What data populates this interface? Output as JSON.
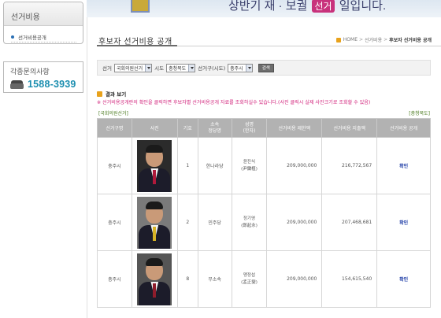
{
  "sidebar": {
    "title": "선거비용",
    "menu_item": "선거비용공개",
    "contact_title": "각종문의사항",
    "contact_number": "1588-3939"
  },
  "banner": {
    "text_before": "상반기 재 · 보궐",
    "chip": "선거",
    "text_after": "일입니다."
  },
  "page": {
    "title": "후보자 선거비용 공개",
    "breadcrumb": [
      "HOME",
      "선거비용",
      "후보자 선거비용 공개"
    ]
  },
  "search": {
    "election_label": "선거",
    "election_value": "국회의원선거",
    "province_label": "시도",
    "province_value": "충청북도",
    "district_label": "선거구(시도)",
    "district_value": "충주시",
    "button": "검색"
  },
  "results": {
    "label": "결과 보기",
    "notice": "※ 선거비용공개란의 확인을 클릭하면 후보자별 선거비용공개 자료를 조회하실수 있습니다.(사진 클릭시 실제 사진크기로 조회할 수 있음)",
    "tag_left": "[국회의원선거]",
    "tag_right": "[충청북도]",
    "headers": [
      "선거구명",
      "사진",
      "기호",
      "소속\n정당명",
      "성명\n(한자)",
      "선거비용 제한액",
      "선거비용 지출액",
      "선거비용 공개"
    ],
    "rows": [
      {
        "district": "충주시",
        "number": "1",
        "party": "한나라당",
        "name": "윤진식",
        "hanja": "(尹鎭植)",
        "limit": "209,000,000",
        "spent": "216,772,567",
        "action": "확인"
      },
      {
        "district": "충주시",
        "number": "2",
        "party": "민주당",
        "name": "정기영",
        "hanja": "(鄭起永)",
        "limit": "209,000,000",
        "spent": "207,468,681",
        "action": "확인"
      },
      {
        "district": "충주시",
        "number": "8",
        "party": "무소속",
        "name": "맹정섭",
        "hanja": "(孟正燮)",
        "limit": "209,000,000",
        "spent": "154,615,540",
        "action": "확인"
      }
    ]
  },
  "colors": {
    "accent": "#1d8fb0",
    "notice": "#d1227b",
    "link": "#2341a8",
    "header_bg": "#b2b2b2"
  }
}
